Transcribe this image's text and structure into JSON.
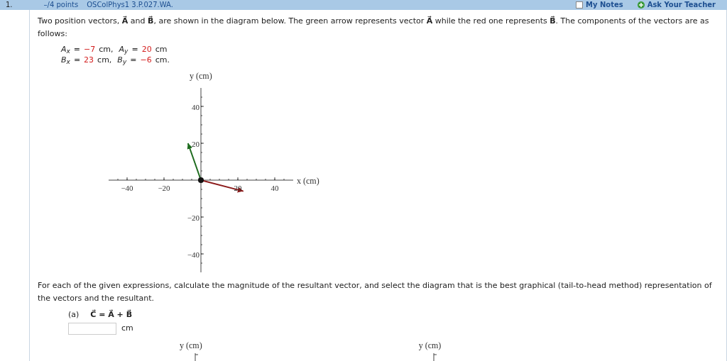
{
  "header": {
    "points": "–/4 points",
    "problem_id": "OSColPhys1 3.P.027.WA.",
    "number": "1.",
    "links": [
      {
        "label": "My Notes",
        "kind": "checkbox",
        "checked": false
      },
      {
        "label": "Ask Your Teacher",
        "kind": "plus"
      }
    ]
  },
  "intro": "Two position vectors, **A⃗** and **B⃗**, are shown in the diagram below. The green arrow represents vector **A⃗** while the red one represents **B⃗**. The components of the vectors are as follows:",
  "components": [
    [
      {
        "symbol": "A",
        "sub": "x",
        "relation": "=",
        "value": "−7",
        "unit": "cm,"
      },
      {
        "symbol": "A",
        "sub": "y",
        "relation": "=",
        "value": "20",
        "unit": "cm"
      }
    ],
    [
      {
        "symbol": "B",
        "sub": "x",
        "relation": "=",
        "value": "23",
        "unit": "cm,"
      },
      {
        "symbol": "B",
        "sub": "y",
        "relation": "=",
        "value": "−6",
        "unit": "cm."
      }
    ]
  ],
  "chart": {
    "chart_data": {
      "type": "line",
      "xlabel": "x (cm)",
      "ylabel": "y (cm)",
      "xlim": [
        -50,
        50
      ],
      "ylim": [
        -50,
        50
      ],
      "xticks": [
        {
          "value": -40,
          "label": "−40"
        },
        {
          "value": -20,
          "label": "−20"
        },
        {
          "value": 20,
          "label": "20"
        },
        {
          "value": 40,
          "label": "40"
        }
      ],
      "yticks": [
        {
          "value": -40,
          "label": "−40"
        },
        {
          "value": -20,
          "label": "−20"
        },
        {
          "value": 20,
          "label": "20"
        },
        {
          "value": 40,
          "label": "40"
        }
      ],
      "series": [
        {
          "color": "#1e6b1e",
          "x": [
            0,
            -7
          ],
          "values": [
            0,
            20
          ]
        },
        {
          "color": "#8b1a1a",
          "x": [
            0,
            23
          ],
          "values": [
            0,
            -6
          ]
        }
      ]
    }
  },
  "instructions": "For each of the given expressions, calculate the magnitude of the resultant vector, and select the diagram that is the best graphical (tail-to-head method) representation of the vectors and the resultant.",
  "parts": [
    {
      "label": "(a)",
      "expression": "C⃗ = A⃗ + B⃗",
      "unit": "cm",
      "diagrams": [
        {
          "ylabel": "y (cm)"
        },
        {
          "ylabel": "y (cm)"
        }
      ]
    }
  ]
}
